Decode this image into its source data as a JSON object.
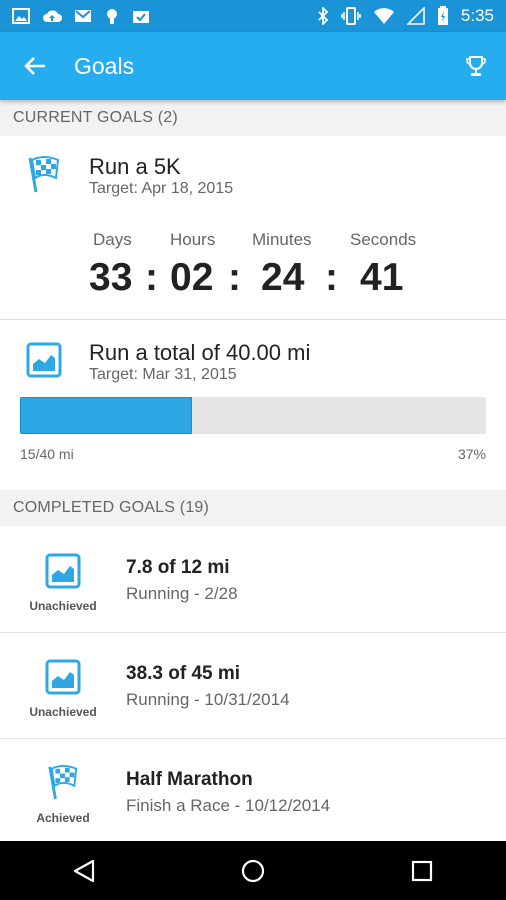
{
  "status_bar": {
    "time": "5:35"
  },
  "app_bar": {
    "title": "Goals"
  },
  "current_goals": {
    "header": "CURRENT GOALS (2)",
    "countdown_goal": {
      "title": "Run a 5K",
      "target": "Target: Apr 18, 2015",
      "labels": [
        "Days",
        "Hours",
        "Minutes",
        "Seconds"
      ],
      "values": [
        "33",
        "02",
        "24",
        "41"
      ],
      "separator": ":"
    },
    "distance_goal": {
      "title": "Run a total of 40.00 mi",
      "target": "Target: Mar 31, 2015",
      "progress_text": "15/40 mi",
      "percent_text": "37%",
      "progress_fraction": 0.37
    }
  },
  "completed_goals": {
    "header": "COMPLETED GOALS (19)",
    "items": [
      {
        "title": "7.8 of 12 mi",
        "subtitle": "Running - 2/28",
        "status": "Unachieved",
        "icon": "chart-icon"
      },
      {
        "title": "38.3 of 45 mi",
        "subtitle": "Running - 10/31/2014",
        "status": "Unachieved",
        "icon": "chart-icon"
      },
      {
        "title": "Half Marathon",
        "subtitle": "Finish a Race - 10/12/2014",
        "status": "Achieved",
        "icon": "checkered-flag-icon"
      }
    ]
  },
  "colors": {
    "accent": "#25adf0",
    "status_bar": "#1a94d6",
    "progress": "#2ea8e4"
  }
}
